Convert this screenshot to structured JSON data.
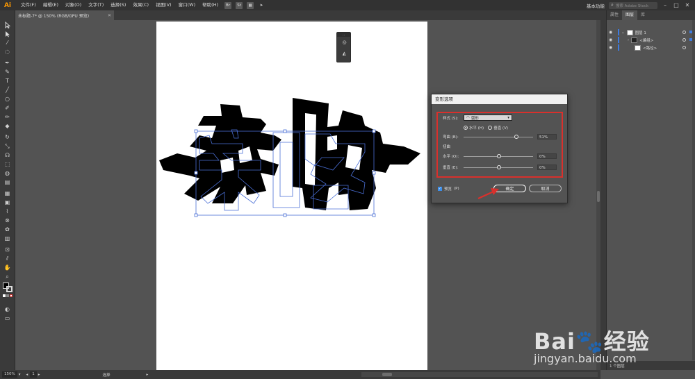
{
  "app": {
    "logo": "Ai"
  },
  "menubar": {
    "items": [
      "文件(F)",
      "编辑(E)",
      "对象(O)",
      "文字(T)",
      "选择(S)",
      "效果(C)",
      "视图(V)",
      "窗口(W)",
      "帮助(H)"
    ],
    "bridge": "Br",
    "stock": "St",
    "workspace": "基本功能",
    "search_placeholder": "搜索 Adobe Stock"
  },
  "document": {
    "tab_title": "未标题-7* @ 150% (RGB/GPU 预览)",
    "artwork_text": "亲吻"
  },
  "warp_dialog": {
    "title": "变形选项",
    "style_label": "样式 (S):",
    "style_value": "弧形",
    "horizontal_label": "水平 (H)",
    "vertical_label": "垂直 (V)",
    "bend_label": "弯曲 (B):",
    "bend_value": "51%",
    "bend_fraction": 0.76,
    "distortion_label": "扭曲",
    "dist_h_label": "水平 (O):",
    "dist_h_value": "0%",
    "dist_v_label": "垂直 (E):",
    "dist_v_value": "0%",
    "preview_label": "预览",
    "preview_key": "(P)",
    "ok_label": "确定",
    "cancel_label": "取消"
  },
  "layers_panel": {
    "tabs": [
      "属性",
      "图层",
      "库"
    ],
    "active_tab": "图层",
    "layers": [
      {
        "name": "图层 1",
        "indent": 0
      },
      {
        "name": "<编组>",
        "indent": 1
      },
      {
        "name": "<路径>",
        "indent": 1
      }
    ],
    "footer": "1 个图层"
  },
  "statusbar": {
    "zoom": "150%",
    "artboard": "1",
    "tool": "选择"
  },
  "watermark": {
    "brand": "Bai🐾经验",
    "url": "jingyan.baidu.com"
  },
  "colors": {
    "accent_red": "#d9302c",
    "selection_blue": "#3d7be0",
    "panel_bg": "#535353",
    "logo_orange": "#ff9a00"
  }
}
